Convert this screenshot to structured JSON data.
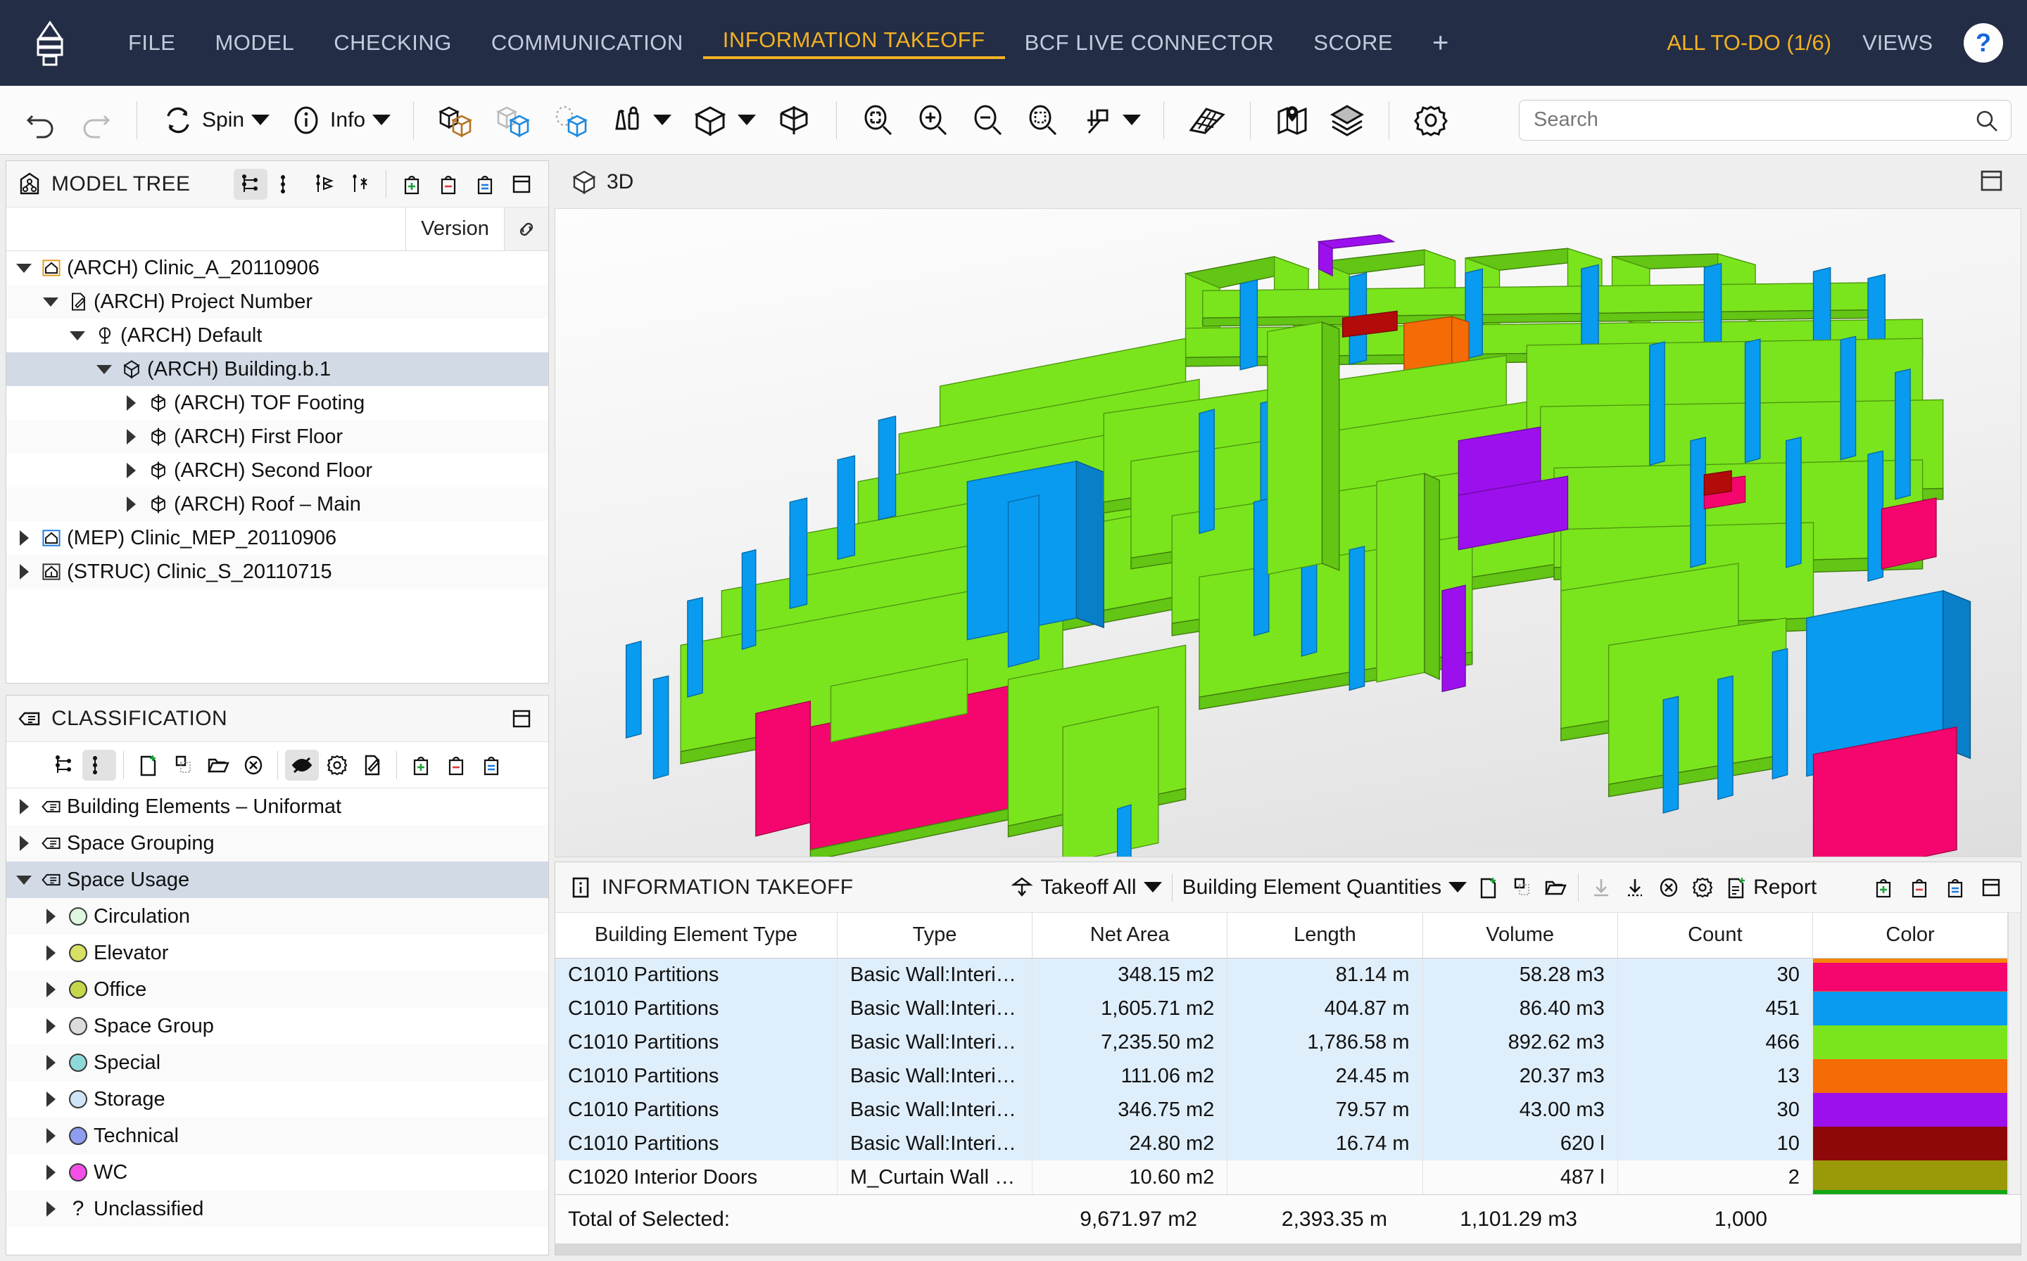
{
  "menubar": {
    "logo_name": "app-logo-icon",
    "items": [
      {
        "label": "FILE",
        "active": false
      },
      {
        "label": "MODEL",
        "active": false
      },
      {
        "label": "CHECKING",
        "active": false
      },
      {
        "label": "COMMUNICATION",
        "active": false
      },
      {
        "label": "INFORMATION TAKEOFF",
        "active": true
      },
      {
        "label": "BCF LIVE CONNECTOR",
        "active": false
      },
      {
        "label": "SCORE",
        "active": false
      }
    ],
    "add_tab": "+",
    "todo": "ALL TO-DO (1/6)",
    "views": "VIEWS",
    "help": "?",
    "bg_color": "#232d45",
    "accent_color": "#f2b124",
    "inactive_color": "#c3cbdd"
  },
  "toolbar": {
    "undo": "undo-icon",
    "redo": "redo-icon",
    "spin_label": "Spin",
    "info_label": "Info",
    "search": {
      "placeholder": "Search",
      "value": ""
    }
  },
  "model_tree": {
    "title": "MODEL TREE",
    "column_version": "Version",
    "rows": [
      {
        "label": "(ARCH) Clinic_A_20110906",
        "depth": 0,
        "arrow": "down",
        "icon": "house-orange-icon",
        "selected": false
      },
      {
        "label": "(ARCH) Project Number",
        "depth": 1,
        "arrow": "down",
        "icon": "document-icon",
        "selected": false
      },
      {
        "label": "(ARCH) Default",
        "depth": 2,
        "arrow": "down",
        "icon": "site-icon",
        "selected": false
      },
      {
        "label": "(ARCH) Building.b.1",
        "depth": 3,
        "arrow": "down",
        "icon": "building-icon",
        "selected": true
      },
      {
        "label": "(ARCH) TOF Footing",
        "depth": 4,
        "arrow": "right",
        "icon": "storey-icon",
        "selected": false
      },
      {
        "label": "(ARCH) First Floor",
        "depth": 4,
        "arrow": "right",
        "icon": "storey-icon",
        "selected": false
      },
      {
        "label": "(ARCH) Second Floor",
        "depth": 4,
        "arrow": "right",
        "icon": "storey-icon",
        "selected": false
      },
      {
        "label": "(ARCH) Roof – Main",
        "depth": 4,
        "arrow": "right",
        "icon": "storey-icon",
        "selected": false
      },
      {
        "label": "(MEP) Clinic_MEP_20110906",
        "depth": 0,
        "arrow": "right",
        "icon": "house-blue-icon",
        "selected": false
      },
      {
        "label": "(STRUC) Clinic_S_20110715",
        "depth": 0,
        "arrow": "right",
        "icon": "house-dark-icon",
        "selected": false
      }
    ]
  },
  "classification": {
    "title": "CLASSIFICATION",
    "rows": [
      {
        "label": "Building Elements – Uniformat",
        "depth": 0,
        "arrow": "right",
        "icon": "tag-icon",
        "color": null,
        "selected": false
      },
      {
        "label": "Space Grouping",
        "depth": 0,
        "arrow": "right",
        "icon": "tag-icon",
        "color": null,
        "selected": false
      },
      {
        "label": "Space Usage",
        "depth": 0,
        "arrow": "down",
        "icon": "tag-icon",
        "color": null,
        "selected": true
      },
      {
        "label": "Circulation",
        "depth": 1,
        "arrow": "right",
        "icon": "dot-icon",
        "color": "#ddf8df",
        "selected": false
      },
      {
        "label": "Elevator",
        "depth": 1,
        "arrow": "right",
        "icon": "dot-icon",
        "color": "#d7e063",
        "selected": false
      },
      {
        "label": "Office",
        "depth": 1,
        "arrow": "right",
        "icon": "dot-icon",
        "color": "#c6d84a",
        "selected": false
      },
      {
        "label": "Space Group",
        "depth": 1,
        "arrow": "right",
        "icon": "dot-icon",
        "color": "#dcdcdc",
        "selected": false
      },
      {
        "label": "Special",
        "depth": 1,
        "arrow": "right",
        "icon": "dot-icon",
        "color": "#8ed8d8",
        "selected": false
      },
      {
        "label": "Storage",
        "depth": 1,
        "arrow": "right",
        "icon": "dot-icon",
        "color": "#cfe5f7",
        "selected": false
      },
      {
        "label": "Technical",
        "depth": 1,
        "arrow": "right",
        "icon": "dot-icon",
        "color": "#8f9df0",
        "selected": false
      },
      {
        "label": "WC",
        "depth": 1,
        "arrow": "right",
        "icon": "dot-icon",
        "color": "#f44ee8",
        "selected": false
      },
      {
        "label": "Unclassified",
        "depth": 1,
        "arrow": "right",
        "icon": "question-icon",
        "color": null,
        "selected": false
      }
    ]
  },
  "viewport": {
    "tab_label": "3D",
    "tab_icon": "cube-icon"
  },
  "takeoff": {
    "title": "INFORMATION TAKEOFF",
    "takeoff_all": "Takeoff All",
    "quantities_select": "Building Element Quantities",
    "report_label": "Report",
    "columns": [
      "Building Element Type",
      "Type",
      "Net Area",
      "Length",
      "Volume",
      "Count",
      "Color"
    ],
    "rows": [
      {
        "element": "C1010 Partitions",
        "type": "Basic Wall:Interior ...",
        "net_area": "348.15 m2",
        "length": "81.14 m",
        "volume": "58.28 m3",
        "count": "30",
        "color": "#f5056e",
        "selected": true
      },
      {
        "element": "C1010 Partitions",
        "type": "Basic Wall:Interior ...",
        "net_area": "1,605.71 m2",
        "length": "404.87 m",
        "volume": "86.40 m3",
        "count": "451",
        "color": "#089bf0",
        "selected": true
      },
      {
        "element": "C1010 Partitions",
        "type": "Basic Wall:Interior ...",
        "net_area": "7,235.50 m2",
        "length": "1,786.58 m",
        "volume": "892.62 m3",
        "count": "466",
        "color": "#7ae51c",
        "selected": true
      },
      {
        "element": "C1010 Partitions",
        "type": "Basic Wall:Interior ...",
        "net_area": "111.06 m2",
        "length": "24.45 m",
        "volume": "20.37 m3",
        "count": "13",
        "color": "#f56b06",
        "selected": true
      },
      {
        "element": "C1010 Partitions",
        "type": "Basic Wall:Interior ...",
        "net_area": "346.75 m2",
        "length": "79.57 m",
        "volume": "43.00 m3",
        "count": "30",
        "color": "#9d10ee",
        "selected": true
      },
      {
        "element": "C1010 Partitions",
        "type": "Basic Wall:Interior ...",
        "net_area": "24.80 m2",
        "length": "16.74 m",
        "volume": "620 l",
        "count": "10",
        "color": "#8f0808",
        "selected": true
      },
      {
        "element": "C1020 Interior Doors",
        "type": "M_Curtain Wall Db...",
        "net_area": "10.60 m2",
        "length": "",
        "volume": "487 l",
        "count": "2",
        "color": "#9a9a09",
        "selected": false
      }
    ],
    "color_top_sliver": "#f58606",
    "color_bottom_sliver": "#16a616",
    "total": {
      "label": "Total of Selected:",
      "net_area": "9,671.97 m2",
      "length": "2,393.35 m",
      "volume": "1,101.29 m3",
      "count": "1,000"
    }
  }
}
